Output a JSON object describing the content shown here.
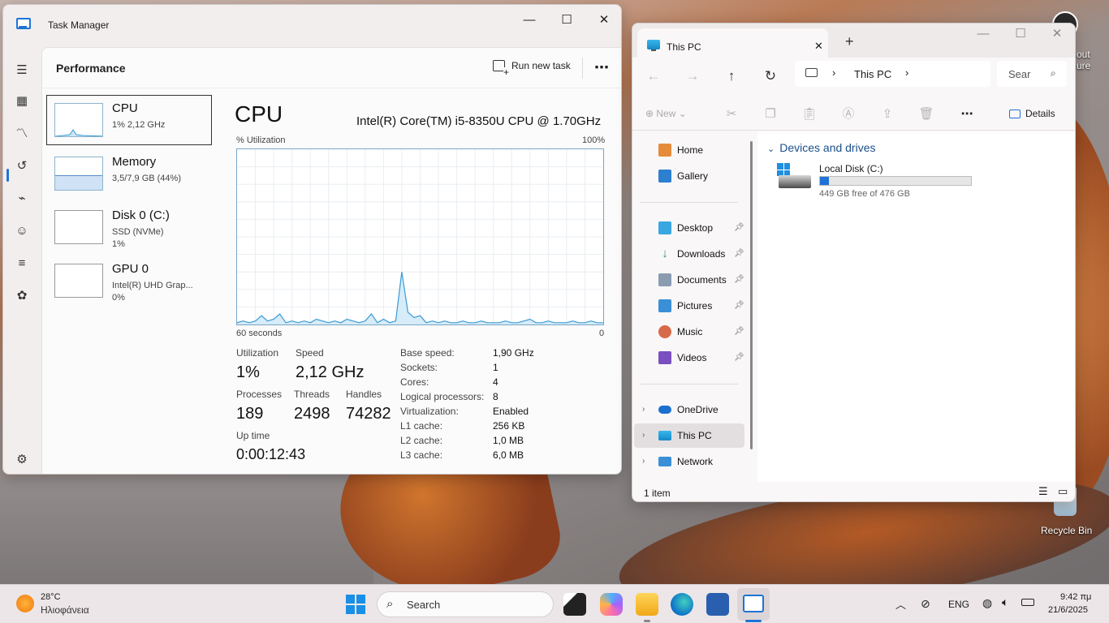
{
  "task_manager": {
    "title": "Task Manager",
    "heading": "Performance",
    "run_new_task": "Run new task",
    "more": "⋯",
    "perf_items": [
      {
        "name": "CPU",
        "sub1": "1% 2,12 GHz",
        "sub2": "",
        "sub3": ""
      },
      {
        "name": "Memory",
        "sub1": "3,5/7,9 GB (44%)",
        "sub2": "",
        "sub3": ""
      },
      {
        "name": "Disk 0 (C:)",
        "sub1": "SSD (NVMe)",
        "sub2": "1%",
        "sub3": ""
      },
      {
        "name": "GPU 0",
        "sub1": "Intel(R) UHD Grap...",
        "sub2": "0%",
        "sub3": ""
      }
    ],
    "cpu": {
      "title": "CPU",
      "model": "Intel(R) Core(TM) i5-8350U CPU @ 1.70GHz",
      "util_label": "% Utilization",
      "util_max": "100%",
      "time_left": "60 seconds",
      "time_right": "0",
      "utilization_label": "Utilization",
      "utilization": "1%",
      "speed_label": "Speed",
      "speed": "2,12 GHz",
      "processes_label": "Processes",
      "processes": "189",
      "threads_label": "Threads",
      "threads": "2498",
      "handles_label": "Handles",
      "handles": "74282",
      "uptime_label": "Up time",
      "uptime": "0:00:12:43",
      "specs": [
        {
          "k": "Base speed:",
          "v": "1,90 GHz"
        },
        {
          "k": "Sockets:",
          "v": "1"
        },
        {
          "k": "Cores:",
          "v": "4"
        },
        {
          "k": "Logical processors:",
          "v": "8"
        },
        {
          "k": "Virtualization:",
          "v": "Enabled"
        },
        {
          "k": "L1 cache:",
          "v": "256 KB"
        },
        {
          "k": "L2 cache:",
          "v": "1,0 MB"
        },
        {
          "k": "L3 cache:",
          "v": "6,0 MB"
        }
      ],
      "graph_values": [
        1,
        2,
        1,
        2,
        5,
        2,
        3,
        6,
        1,
        2,
        1,
        2,
        1,
        3,
        2,
        1,
        2,
        1,
        3,
        2,
        1,
        2,
        6,
        1,
        3,
        1,
        2,
        30,
        7,
        4,
        5,
        1,
        2,
        1,
        2,
        1,
        1,
        2,
        1,
        1,
        2,
        1,
        1,
        1,
        2,
        1,
        1,
        2,
        3,
        1,
        1,
        2,
        1,
        1,
        1,
        2,
        1,
        1,
        2,
        1,
        1
      ]
    }
  },
  "explorer": {
    "tab_title": "This PC",
    "address_crumb": "This PC",
    "search_placeholder": "Sear",
    "new_label": "New",
    "details_label": "Details",
    "nav": {
      "home": "Home",
      "gallery": "Gallery",
      "desktop": "Desktop",
      "downloads": "Downloads",
      "documents": "Documents",
      "pictures": "Pictures",
      "music": "Music",
      "videos": "Videos",
      "onedrive": "OneDrive",
      "thispc": "This PC",
      "network": "Network"
    },
    "section": "Devices and drives",
    "drive_name": "Local Disk (C:)",
    "drive_free": "449 GB free of 476 GB",
    "drive_used_fraction": 0.057,
    "status": "1 item"
  },
  "desktop": {
    "recycle_bin": "Recycle Bin",
    "partial_text_1": "out",
    "partial_text_2": "ure"
  },
  "taskbar": {
    "temp": "28°C",
    "weather": "Ηλιοφάνεια",
    "search": "Search",
    "lang": "ENG",
    "time": "9:42 πμ",
    "date": "21/6/2025"
  }
}
